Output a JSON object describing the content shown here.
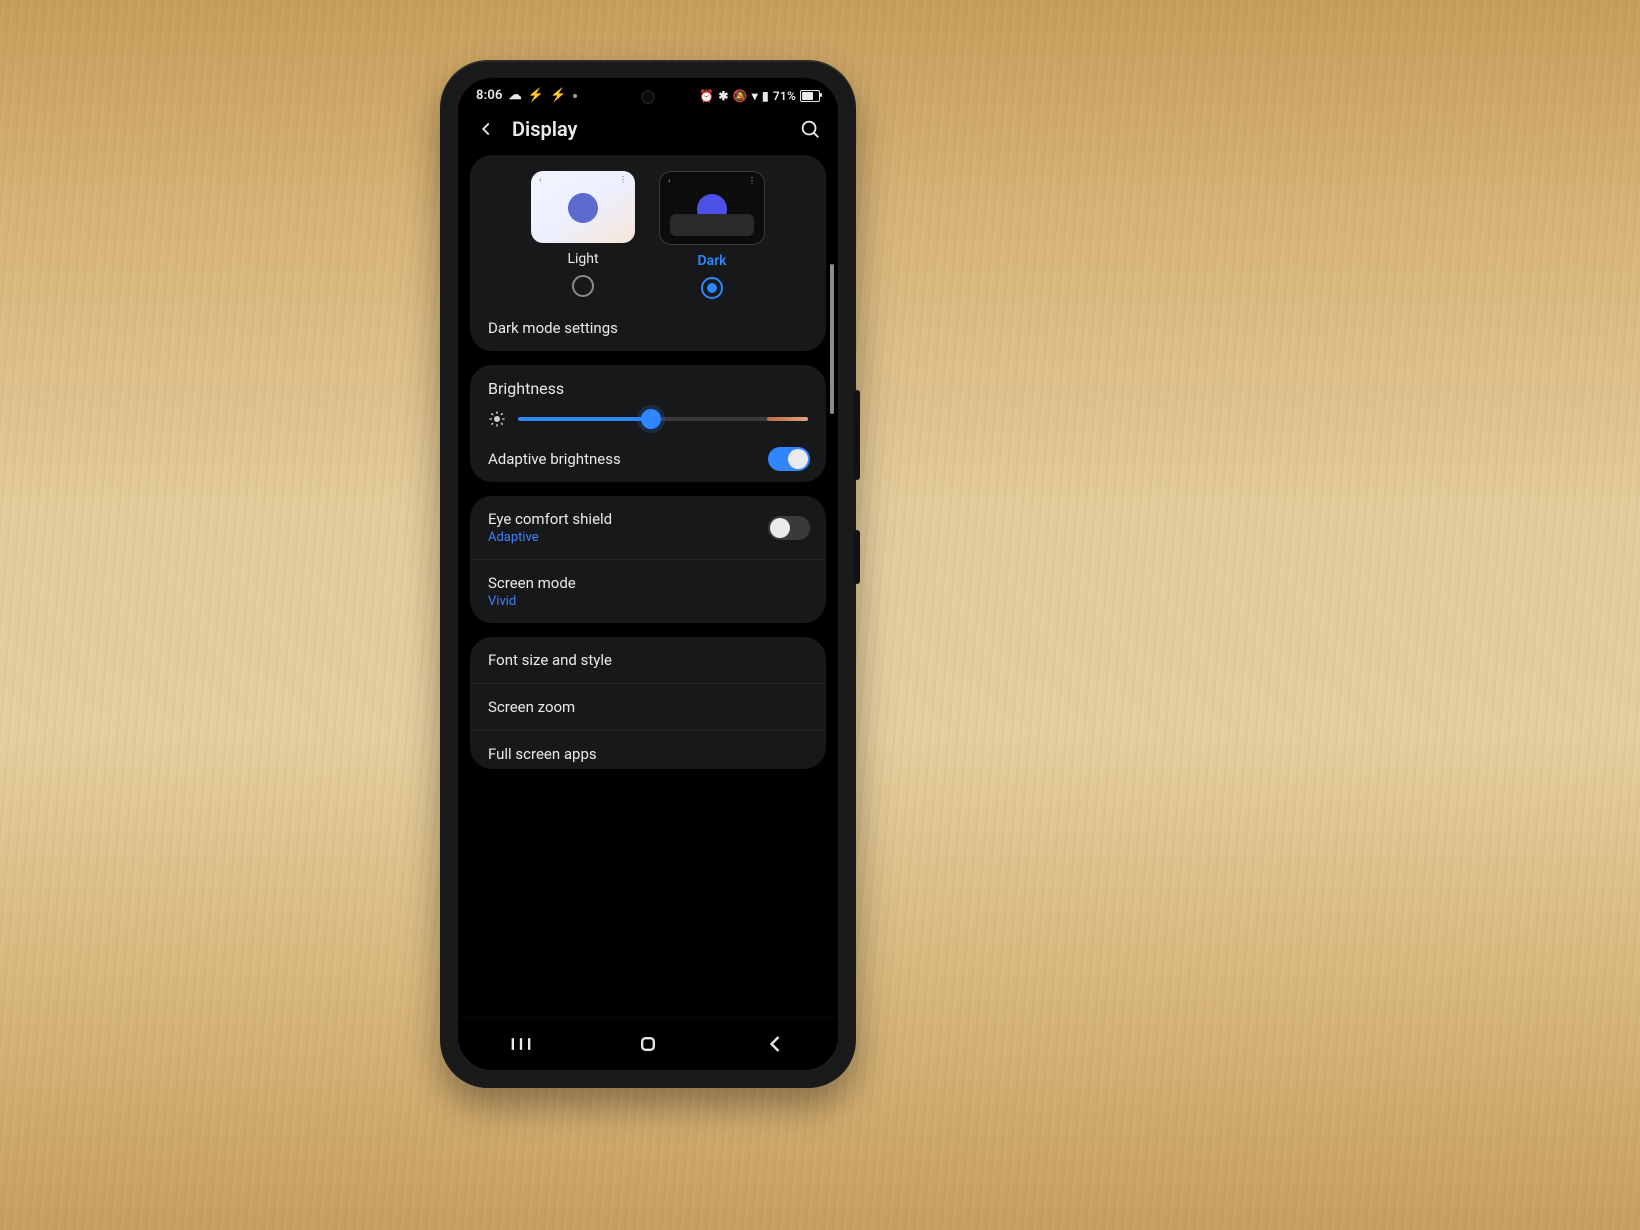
{
  "status": {
    "time": "8:06",
    "battery_pct": "71%",
    "battery_fill_pct": 71,
    "icon_names": [
      "alarm-icon",
      "cog-icon",
      "mute-icon",
      "wifi-icon",
      "signal-icon"
    ]
  },
  "header": {
    "title": "Display"
  },
  "theme": {
    "light_label": "Light",
    "dark_label": "Dark",
    "selected": "dark",
    "settings_label": "Dark mode settings"
  },
  "brightness": {
    "title": "Brightness",
    "value_pct": 46,
    "adaptive_label": "Adaptive brightness",
    "adaptive_on": true
  },
  "eye_comfort": {
    "title": "Eye comfort shield",
    "sub": "Adaptive",
    "on": false
  },
  "screen_mode": {
    "title": "Screen mode",
    "sub": "Vivid"
  },
  "font_row": {
    "title": "Font size and style"
  },
  "zoom_row": {
    "title": "Screen zoom"
  },
  "fullscreen_row": {
    "title": "Full screen apps"
  },
  "nav_icons": [
    "recent-apps-icon",
    "home-icon",
    "back-icon"
  ]
}
